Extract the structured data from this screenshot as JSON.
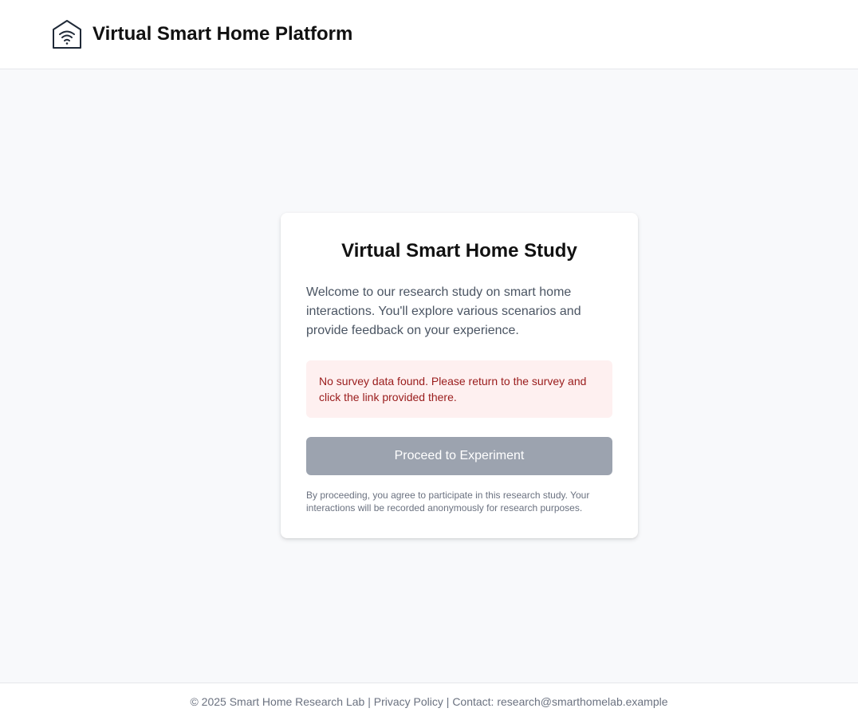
{
  "header": {
    "logo_icon": "smart-home-wifi-icon",
    "title": "Virtual Smart Home Platform"
  },
  "card": {
    "title": "Virtual Smart Home Study",
    "intro": "Welcome to our research study on smart home interactions. You'll explore various scenarios and provide feedback on your experience.",
    "alert_message": "No survey data found. Please return to the survey and click the link provided there.",
    "proceed_label": "Proceed to Experiment",
    "consent_note": "By proceeding, you agree to participate in this research study. Your interactions will be recorded anonymously for research purposes."
  },
  "footer": {
    "copyright": "© 2025 Smart Home Research Lab",
    "separator": " | ",
    "privacy_label": "Privacy Policy",
    "contact": "Contact: research@smarthomelab.example"
  },
  "colors": {
    "background": "#f8f9fb",
    "alert_background": "#fef0f0",
    "alert_text": "#991b1b",
    "button_disabled": "#9ca3af"
  }
}
